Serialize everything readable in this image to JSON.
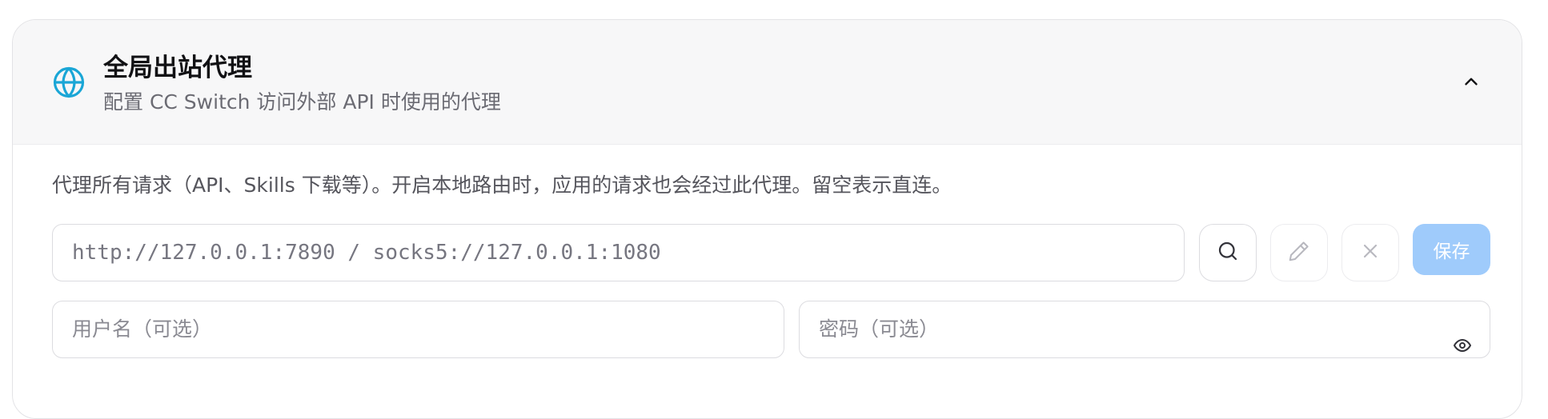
{
  "section": {
    "title": "全局出站代理",
    "subtitle": "配置 CC Switch 访问外部 API 时使用的代理",
    "description": "代理所有请求（API、Skills 下载等）。开启本地路由时，应用的请求也会经过此代理。留空表示直连。"
  },
  "proxy": {
    "url_placeholder": "http://127.0.0.1:7890 / socks5://127.0.0.1:1080",
    "username_placeholder": "用户名（可选）",
    "password_placeholder": "密码（可选）",
    "save_label": "保存"
  },
  "icons": {
    "section": "globe-icon",
    "collapse": "chevron-up-icon",
    "test": "search-icon",
    "detect": "pen-icon",
    "clear": "close-icon",
    "password_toggle": "eye-icon"
  },
  "colors": {
    "accent": "#1aa6d6",
    "save_button": "#9fcbfb",
    "header_background": "#f7f7f8"
  }
}
